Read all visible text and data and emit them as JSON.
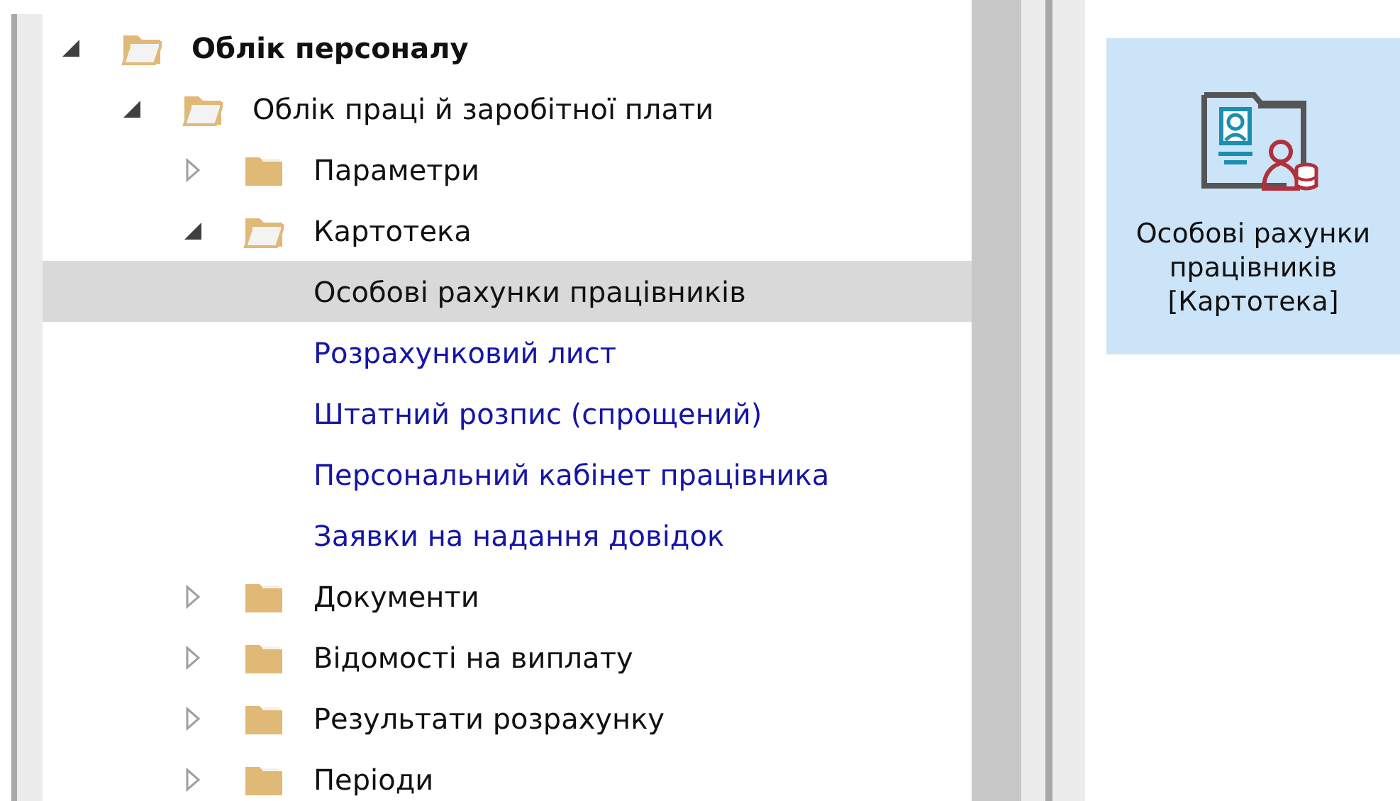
{
  "tree": [
    {
      "label": "Облік персоналу",
      "kind": "folder",
      "expanded": true,
      "children": [
        {
          "label": "Облік праці й заробітної плати",
          "kind": "folder",
          "expanded": true,
          "children": [
            {
              "label": "Параметри",
              "kind": "folder",
              "expanded": false
            },
            {
              "label": "Картотека",
              "kind": "folder",
              "expanded": true,
              "children": [
                {
                  "label": "Особові рахунки працівників",
                  "kind": "leaf",
                  "selected": true
                },
                {
                  "label": "Розрахунковий лист",
                  "kind": "leaf",
                  "selected": false
                },
                {
                  "label": "Штатний розпис (спрощений)",
                  "kind": "leaf",
                  "selected": false
                },
                {
                  "label": "Персональний кабінет працівника",
                  "kind": "leaf",
                  "selected": false
                },
                {
                  "label": "Заявки на надання довідок",
                  "kind": "leaf",
                  "selected": false
                }
              ]
            },
            {
              "label": "Документи",
              "kind": "folder",
              "expanded": false
            },
            {
              "label": "Відомості на виплату",
              "kind": "folder",
              "expanded": false
            },
            {
              "label": "Результати розрахунку",
              "kind": "folder",
              "expanded": false
            },
            {
              "label": "Періоди",
              "kind": "folder",
              "expanded": false
            }
          ]
        }
      ]
    }
  ],
  "tile": {
    "label": "Особові рахунки працівників [Картотека]",
    "selected": true
  }
}
